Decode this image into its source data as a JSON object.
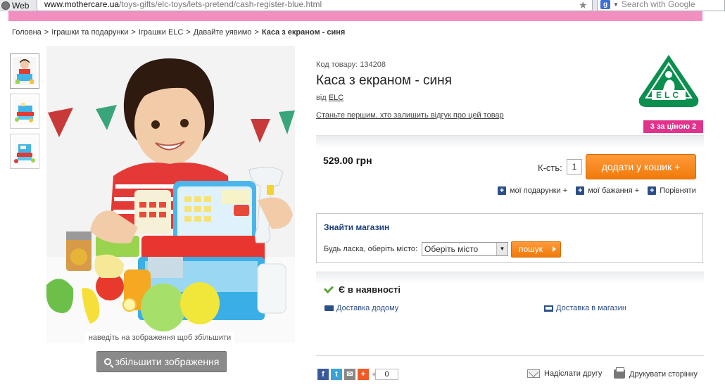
{
  "browser": {
    "tab_label": "Web",
    "url_domain": "www.mothercare.ua",
    "url_path": "/toys-gifts/elc-toys/lets-pretend/cash-register-blue.html",
    "search_engine_badge": "g",
    "search_placeholder": "Search with Google"
  },
  "breadcrumb": {
    "items": [
      "Головна",
      "Іграшки та подарунки",
      "Іграшки ELC",
      "Давайте уявимо"
    ],
    "separator": ">",
    "current": "Каса з екраном - синя"
  },
  "gallery": {
    "hover_hint": "наведіть на зображення щоб збільшити",
    "zoom_button": "збільшити зображення"
  },
  "product": {
    "code_label": "Код товару: 134208",
    "title": "Каса з екраном - синя",
    "brand_prefix": "від",
    "brand_name": "ELC",
    "review_link": "Станьте першим, хто залишить відгук про цей товар",
    "logo_text": "ELC",
    "promo_badge": "3 за ціною 2",
    "price": "529.00 грн",
    "qty_label": "К-сть:",
    "qty_value": "1",
    "add_to_cart": "додати у кошик +",
    "links": {
      "gifts": "мої подарунки +",
      "wishlist": "мої бажання +",
      "compare": "Порівняти"
    }
  },
  "store_finder": {
    "title": "Знайти магазин",
    "label": "Будь ласка, оберіть місто:",
    "selected_city": "Оберіть місто",
    "search_button": "пошук"
  },
  "availability": {
    "status": "Є в наявності",
    "delivery_home": "Доставка додому",
    "delivery_store": "Доставка в магазин"
  },
  "social": {
    "share_count": "0",
    "send_friend": "Надіслати другу",
    "print_page": "Друкувати сторінку"
  },
  "colors": {
    "accent_orange": "#f07a0a",
    "promo_pink": "#e2338c",
    "navy": "#2c4f86",
    "elc_green": "#0b8f4e"
  }
}
